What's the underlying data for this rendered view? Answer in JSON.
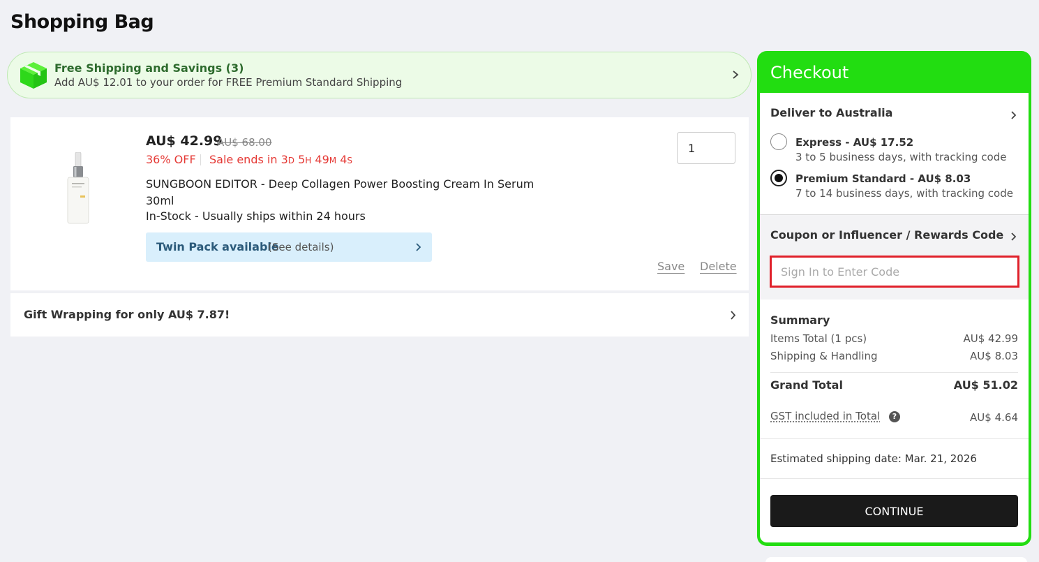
{
  "page": {
    "title": "Shopping Bag"
  },
  "banner": {
    "title": "Free Shipping and Savings (3)",
    "subtitle": "Add AU$ 12.01 to your order for FREE Premium Standard Shipping",
    "icon": "box-icon",
    "accent_color": "#22dd11"
  },
  "item": {
    "price": "AU$ 42.99",
    "original_price": "AU$ 68.00",
    "discount": "36% OFF",
    "sale_prefix": "Sale ends in",
    "countdown": {
      "d": "3",
      "d_unit": "D",
      "h": "5",
      "h_unit": "H",
      "m": "49",
      "m_unit": "M",
      "s": "4",
      "s_unit": "S"
    },
    "name_line1": "SUNGBOON EDITOR - Deep Collagen Power Boosting Cream In Serum",
    "name_line2": "30ml",
    "stock": "In-Stock - Usually ships within 24 hours",
    "twin_title": "Twin Pack available",
    "twin_sub": "(See details)",
    "quantity": "1",
    "save_label": "Save",
    "delete_label": "Delete"
  },
  "gift": {
    "label": "Gift Wrapping for only AU$ 7.87!"
  },
  "checkout": {
    "title": "Checkout",
    "deliver_to": "Deliver to Australia",
    "options": [
      {
        "title": "Express - AU$ 17.52",
        "sub": "3 to 5 business days, with tracking code",
        "selected": false
      },
      {
        "title": "Premium Standard - AU$ 8.03",
        "sub": "7 to 14 business days, with tracking code",
        "selected": true
      }
    ],
    "coupon_title": "Coupon or Influencer / Rewards Code",
    "coupon_placeholder": "Sign In to Enter Code",
    "summary_title": "Summary",
    "items_total_label": "Items Total (1 pcs)",
    "items_total_value": "AU$ 42.99",
    "shipping_label": "Shipping & Handling",
    "shipping_value": "AU$ 8.03",
    "grand_label": "Grand Total",
    "grand_value": "AU$ 51.02",
    "gst_label": "GST included in Total",
    "gst_help": "?",
    "gst_value": "AU$ 4.64",
    "est_shipping": "Estimated shipping date: Mar. 21, 2026",
    "continue_label": "CONTINUE"
  }
}
